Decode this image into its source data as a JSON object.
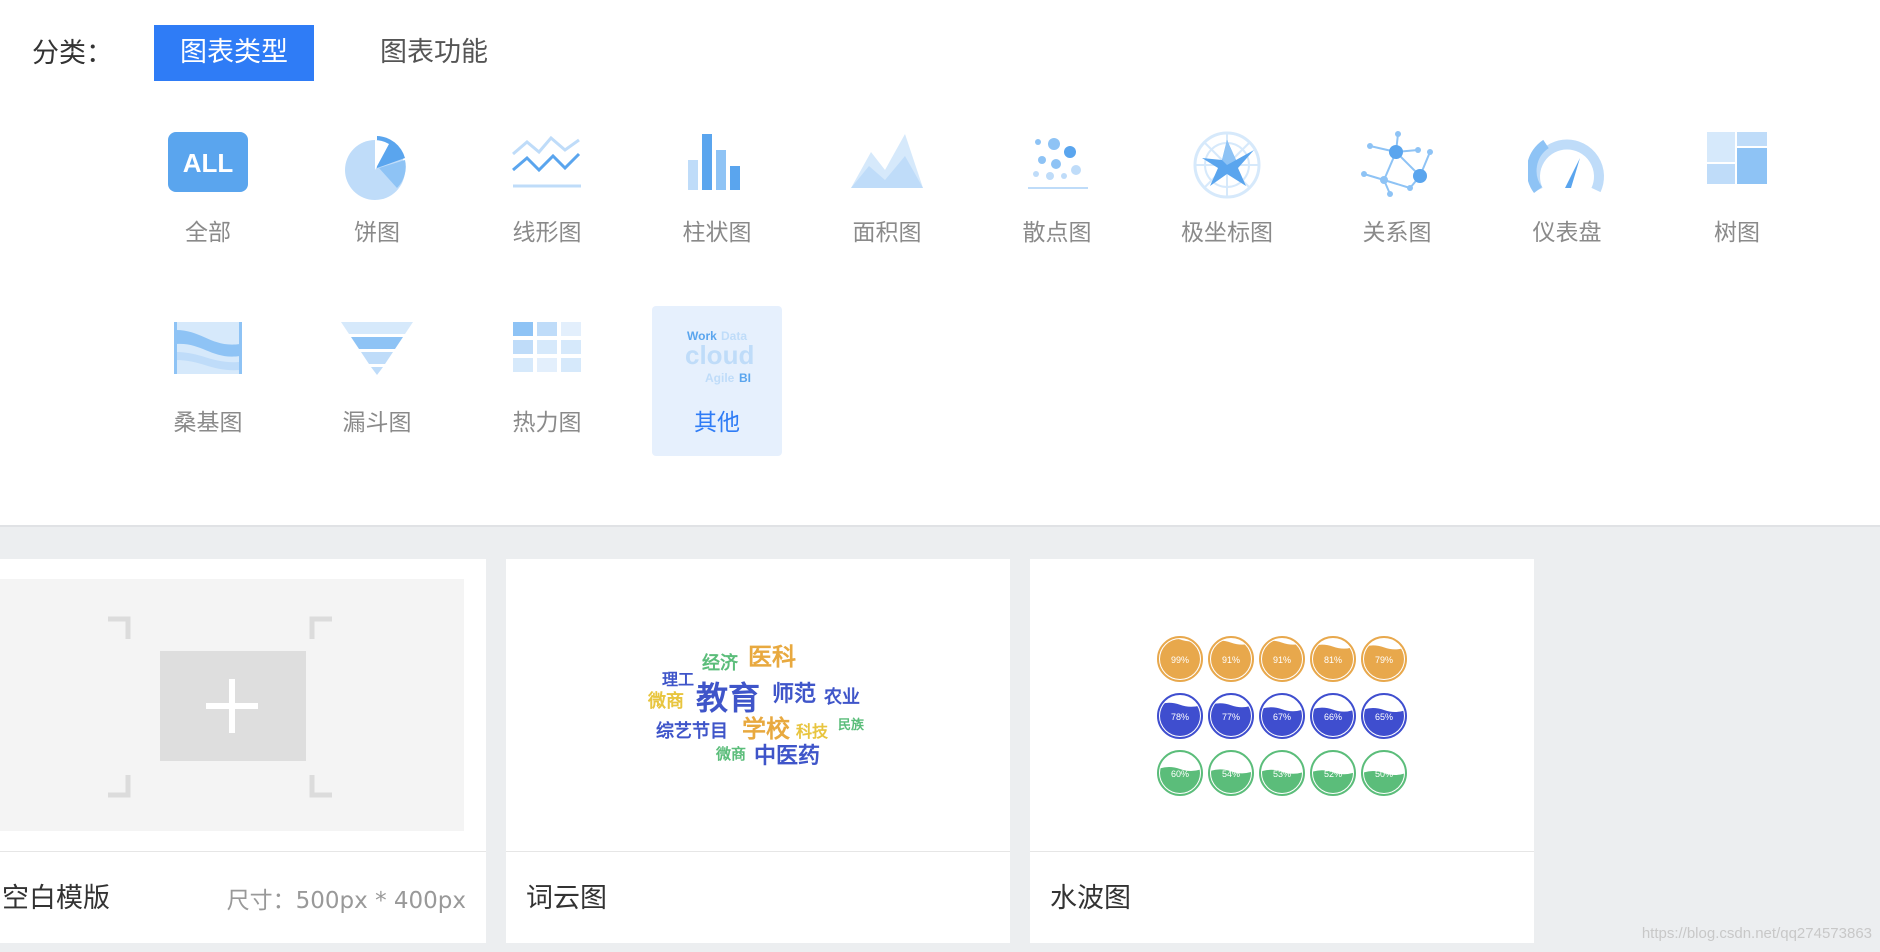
{
  "filter": {
    "label": "分类：",
    "tabs": [
      {
        "label": "图表类型",
        "active": true
      },
      {
        "label": "图表功能",
        "active": false
      }
    ]
  },
  "chart_types": [
    {
      "label": "全部",
      "icon": "all-badge-icon"
    },
    {
      "label": "饼图",
      "icon": "pie-chart-icon"
    },
    {
      "label": "线形图",
      "icon": "line-chart-icon"
    },
    {
      "label": "柱状图",
      "icon": "bar-chart-icon"
    },
    {
      "label": "面积图",
      "icon": "area-chart-icon"
    },
    {
      "label": "散点图",
      "icon": "scatter-chart-icon"
    },
    {
      "label": "极坐标图",
      "icon": "polar-chart-icon"
    },
    {
      "label": "关系图",
      "icon": "graph-chart-icon"
    },
    {
      "label": "仪表盘",
      "icon": "gauge-chart-icon"
    },
    {
      "label": "树图",
      "icon": "treemap-chart-icon"
    },
    {
      "label": "桑基图",
      "icon": "sankey-chart-icon"
    },
    {
      "label": "漏斗图",
      "icon": "funnel-chart-icon"
    },
    {
      "label": "热力图",
      "icon": "heatmap-chart-icon"
    },
    {
      "label": "其他",
      "icon": "other-chart-icon",
      "selected": true
    }
  ],
  "all_badge_text": "ALL",
  "other_icon_text": {
    "line1a": "Work",
    "line1b": "Data",
    "line2": "cloud",
    "line3a": "Agile",
    "line3b": "BI"
  },
  "templates": [
    {
      "name": "空白模版",
      "size": "尺寸：500px * 400px"
    },
    {
      "name": "词云图"
    },
    {
      "name": "水波图"
    }
  ],
  "wordcloud": {
    "words": [
      {
        "text": "经济",
        "color": "#5bbd7a"
      },
      {
        "text": "医科",
        "color": "#e8a93f"
      },
      {
        "text": "理工",
        "color": "#3f55c9"
      },
      {
        "text": "微商",
        "color": "#e8c53f"
      },
      {
        "text": "教育",
        "color": "#3f55c9"
      },
      {
        "text": "师范",
        "color": "#3f55c9"
      },
      {
        "text": "农业",
        "color": "#3f55c9"
      },
      {
        "text": "综艺节目",
        "color": "#3f55c9"
      },
      {
        "text": "学校",
        "color": "#e8a93f"
      },
      {
        "text": "科技",
        "color": "#e8c53f"
      },
      {
        "text": "民族",
        "color": "#5bbd7a"
      },
      {
        "text": "微商",
        "color": "#5bbd7a"
      },
      {
        "text": "中医药",
        "color": "#3f55c9"
      }
    ]
  },
  "liquid": {
    "rows": [
      {
        "color": "#e8a84c",
        "values": [
          "99%",
          "91%",
          "91%",
          "81%",
          "79%"
        ],
        "levels": [
          0.99,
          0.91,
          0.91,
          0.81,
          0.79
        ]
      },
      {
        "color": "#3f4ecf",
        "values": [
          "78%",
          "77%",
          "67%",
          "66%",
          "65%"
        ],
        "levels": [
          0.78,
          0.77,
          0.67,
          0.66,
          0.65
        ]
      },
      {
        "color": "#5bbd7a",
        "values": [
          "60%",
          "54%",
          "53%",
          "52%",
          "50%"
        ],
        "levels": [
          0.6,
          0.54,
          0.53,
          0.52,
          0.5
        ]
      }
    ]
  },
  "watermark": "https://blog.csdn.net/qq274573863",
  "colors": {
    "accent": "#2f7cf6",
    "icon_light": "#bfdcf9",
    "icon_mid": "#8ec3f5",
    "icon_dark": "#5aa5ee"
  }
}
